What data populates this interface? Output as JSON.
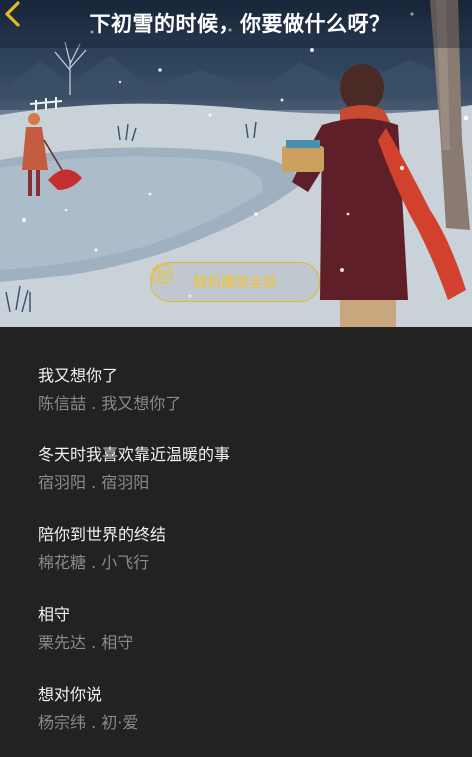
{
  "header": {
    "title": "下初雪的时候，你要做什么呀？",
    "back_icon": "chevron-left-icon",
    "accent_color": "#e2b92a"
  },
  "hero": {
    "play_all_label": "随机播放全部",
    "play_icon": "play-circle-icon"
  },
  "songs": [
    {
      "title": "我又想你了",
      "meta": "陈信喆 . 我又想你了"
    },
    {
      "title": "冬天时我喜欢靠近温暖的事",
      "meta": "宿羽阳 . 宿羽阳"
    },
    {
      "title": "陪你到世界的终结",
      "meta": "棉花糖 . 小飞行"
    },
    {
      "title": "相守",
      "meta": "栗先达 . 相守"
    },
    {
      "title": "想对你说",
      "meta": "杨宗纬 . 初·爱"
    }
  ]
}
